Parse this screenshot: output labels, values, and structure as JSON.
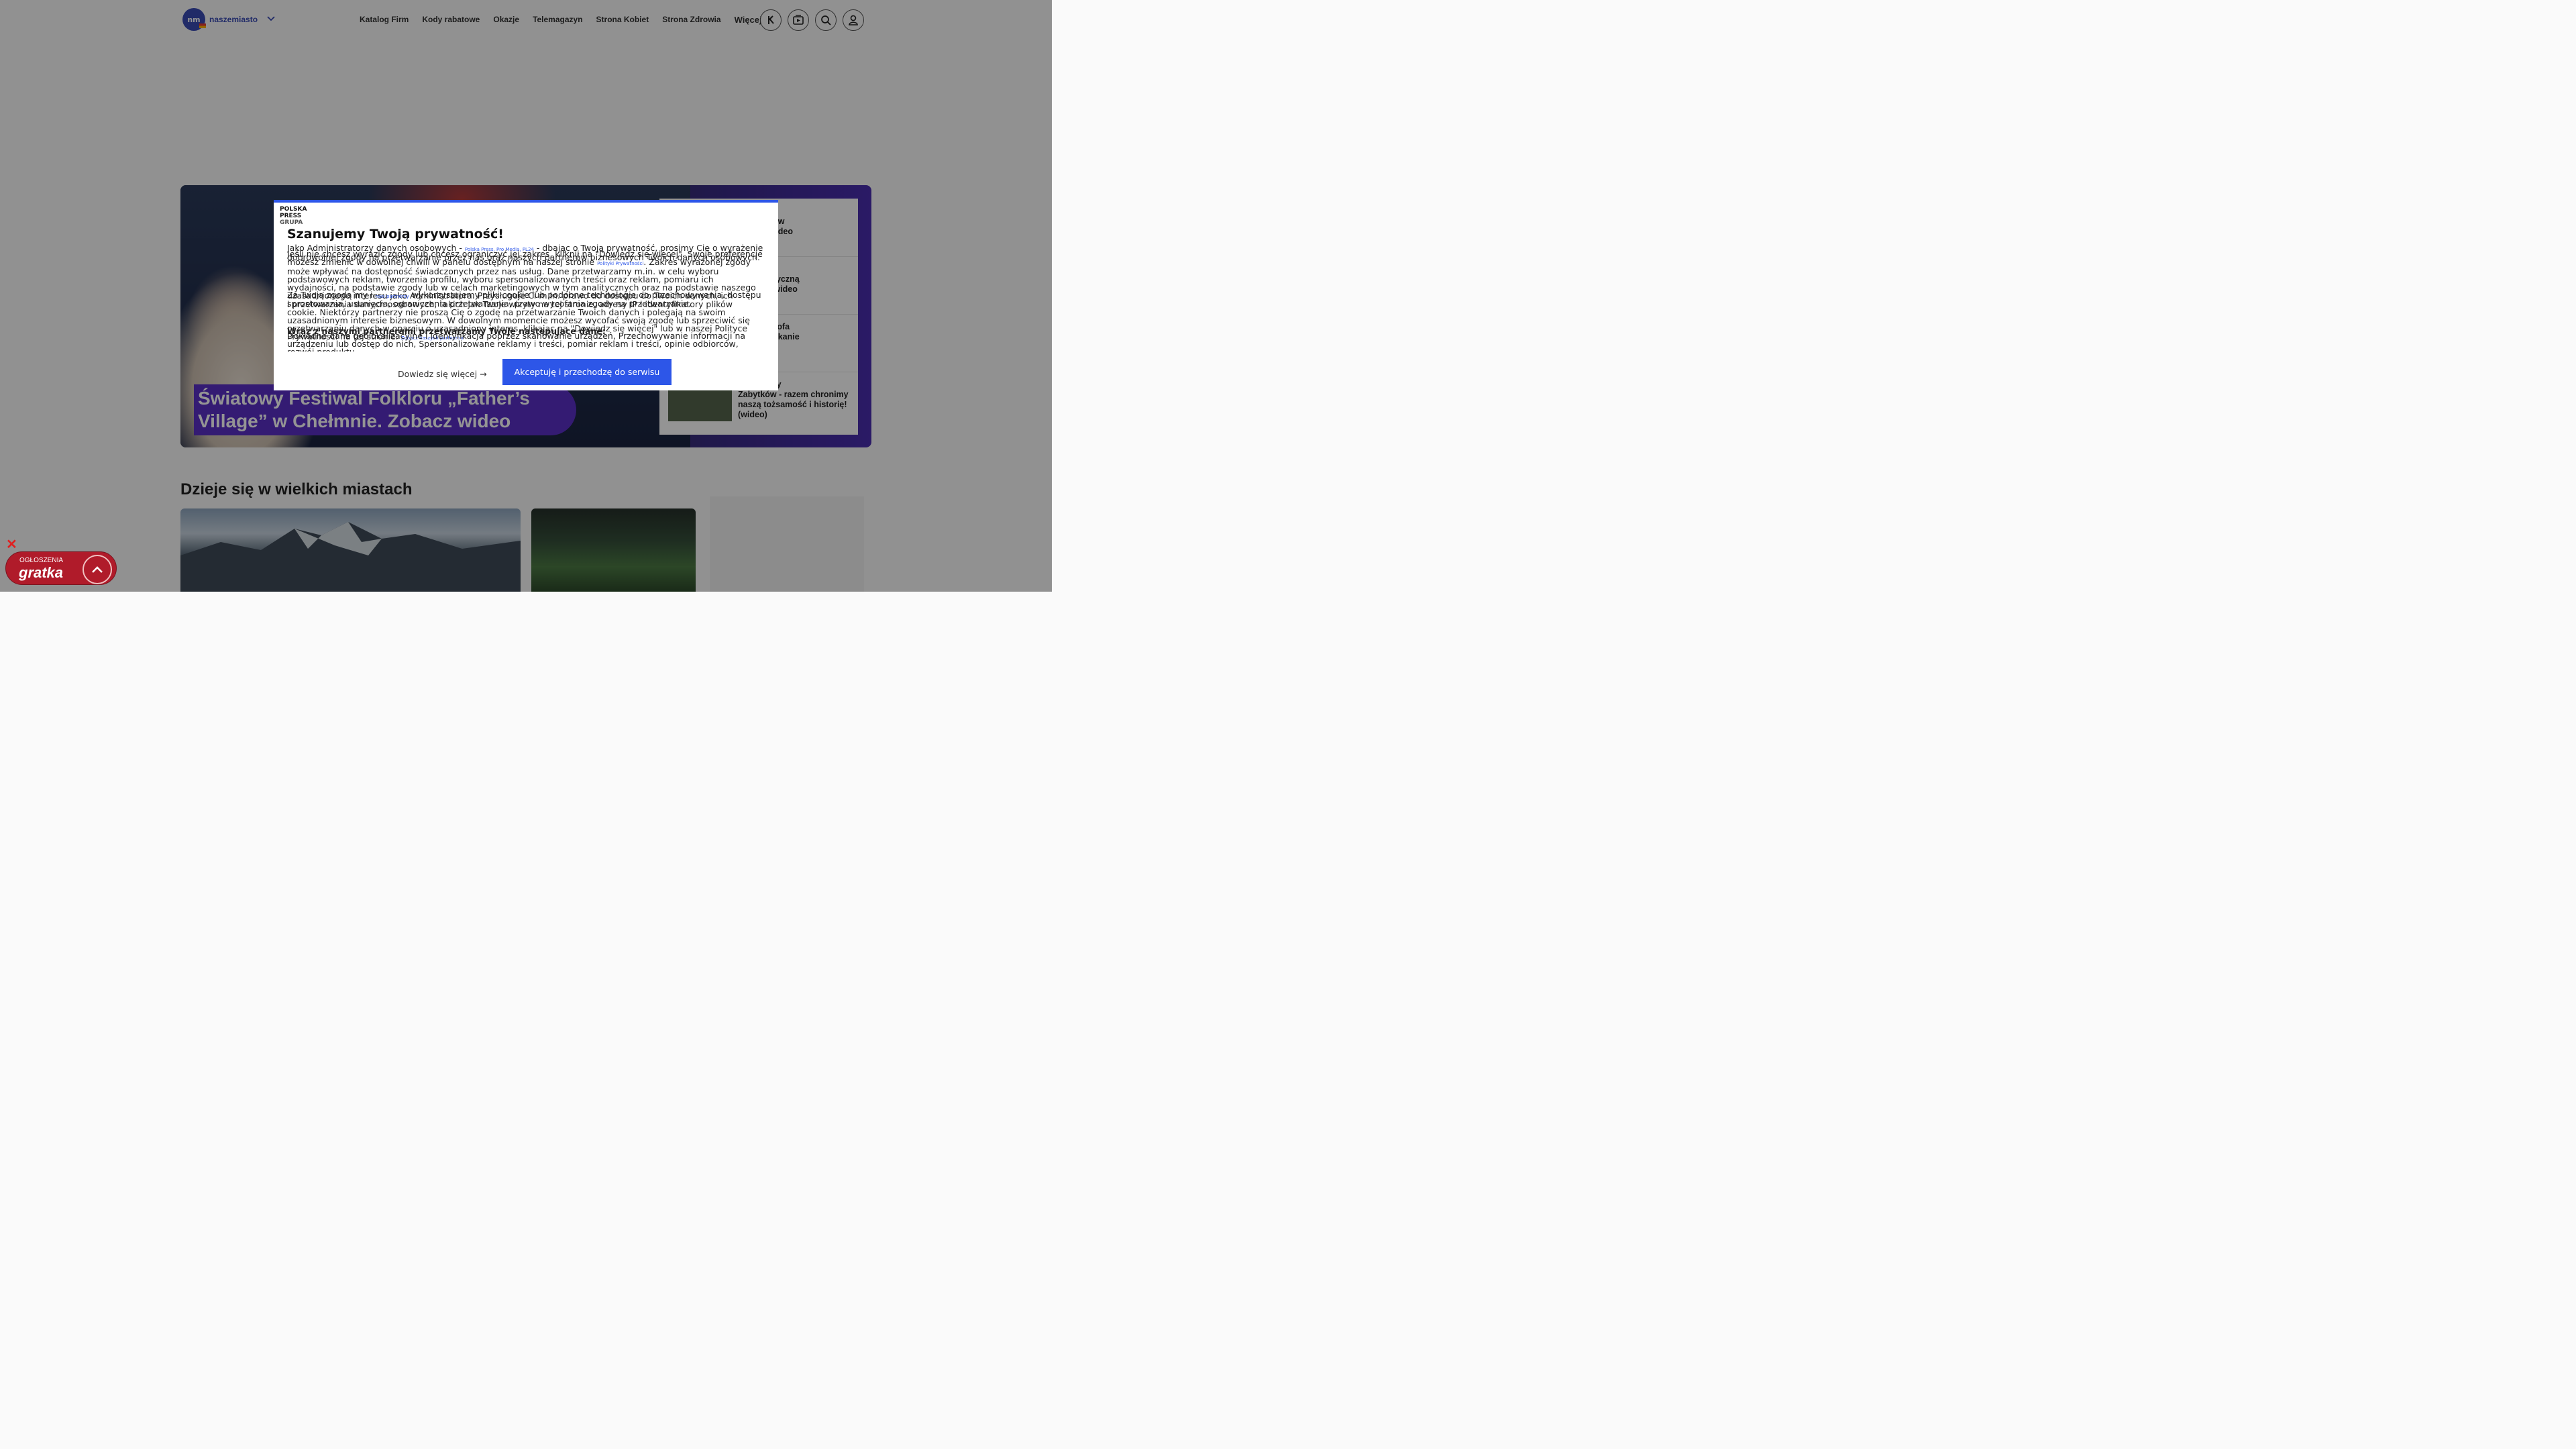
{
  "header": {
    "logo_short": "nm",
    "logo_name": "naszemiasto",
    "nav": [
      "Katalog Firm",
      "Kody rabatowe",
      "Okazje",
      "Telemagazyn",
      "Strona Kobiet",
      "Strona Zdrowia"
    ],
    "more_label": "Więcej",
    "icons": [
      "gazeta-icon",
      "video-icon",
      "search-icon",
      "user-icon"
    ]
  },
  "hero": {
    "title": "Światowy Festiwal Folkloru „Father’s Village” w Chełmnie. Zobacz wideo",
    "side_items": [
      {
        "text": "e zajęcia\ndla dzieci w\nZobacz wideo"
      },
      {
        "text": "można już\nwić elektryczną\n. Zobacz wideo"
      },
      {
        "text": "a. Krzysztofa\ncy Dominikanie\npojazdy\n[WIDEO]"
      },
      {
        "text": "Odbudowy\nZabytków - razem chronimy\nnaszą tożsamość i historię!\n(wideo)"
      }
    ]
  },
  "section": {
    "title": "Dzieje się w wielkich miastach"
  },
  "gratka": {
    "label": "OGŁOSZENIA",
    "name": "gratka"
  },
  "consent": {
    "brand_line1": "POLSKA",
    "brand_line2": "PRESS",
    "brand_line3": "GRUPA",
    "title": "Szanujemy Twoją prywatność!",
    "p1a": "Jako Administratorzy danych osobowych - ",
    "p1_link": "Polska Press, Pro Media, PL24",
    "p1b": " - dbając o Twoją prywatność, prosimy Cię o wyrażenie dobrowolnej zgody na przetwarzanie przez nas oraz naszych partnerów biznesowych Twoich danych osobowych.",
    "p1c": "Jeśli nie chcesz wyrazić zgody lub chcesz ograniczyć jej zakres, kliknij na \"Dowiedz się więcej\". Swoje preferencje możesz zmienić w dowolnej chwili w panelu dostępnym na naszej stronie ",
    "p1_link2": "Polityki Prywatności",
    "p1d": ". Zakres wyrażonej zgody może wpływać na dostępność świadczonych przez nas usług. Dane przetwarzamy m.in. w celu wyboru podstawowych reklam, tworzenia profilu, wyboru spersonalizowanych treści oraz reklam, pomiaru ich wydajności, na podstawie zgody lub w celach marketingowych w tym analitycznych oraz na podstawie naszego uzasadnionego interesu jako Administratora. Przysługuje Ci m.in. prawo do dostępu do Twoich danych, ich sprostowania, usunięcia, ograniczenia przetwarzania, prawo wycofania zgody na przetwarzanie.",
    "p2a": "Za Twoją zgodą my i ",
    "p2_link": "nasi partnerzy",
    "p2b": " wykorzystujemy pliki cookie lub podobne technologie do przechowywania, dostępu i przetwarzania danych osobowych, takich jak Twoje wizyty na tej stronie, adresy IP i identyfikatory plików cookie. Niektórzy partnerzy nie proszą Cię o zgodę na przetwarzanie Twoich danych i polegają na swoim uzasadnionym interesie biznesowym. W dowolnym momencie możesz wycofać swoją zgodę lub sprzeciwić się przetwarzaniu danych w oparciu o uzasadniony interes, klikając na \"Dowiedz się więcej\" lub w naszej Polityce Prywatności na tej stronie. ",
    "p2_link2": "Zobacz naszych partnerów",
    "p3_title": "Wraz z naszymi partnerami przetwarzamy Twoje następujące dane:",
    "p3": "Dokładne dane geolokalizacyjne i identyfikacja poprzez skanowanie urządzeń, Przechowywanie informacji na urządzeniu lub dostęp do nich, Spersonalizowane reklamy i treści, pomiar reklam i treści, opinie odbiorców, rozwój produktu",
    "more_label": "Dowiedz się więcej →",
    "accept_label": "Akceptuję i przechodzę do serwisu"
  },
  "colors": {
    "accent": "#2d56e8",
    "hero_purple": "#5b2fc7",
    "gratka_red": "#b01b2a"
  }
}
